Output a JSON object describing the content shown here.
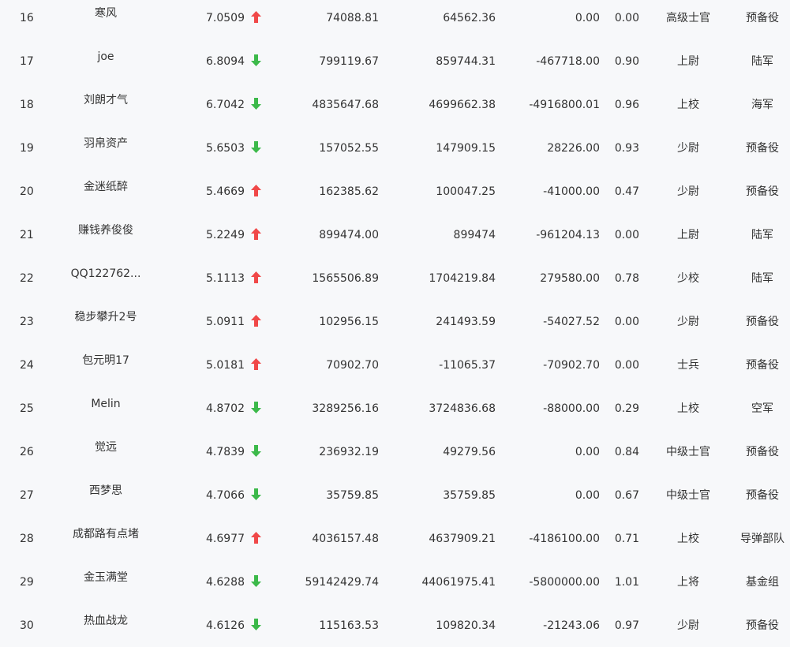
{
  "colors": {
    "up": "#f04848",
    "down": "#3cb94a",
    "text": "#333333",
    "background": "#f7f8fa"
  },
  "rows": [
    {
      "rank": "16",
      "name": "寒风",
      "score": "7.0509",
      "trend": "up",
      "v1": "74088.81",
      "v2": "64562.36",
      "v3": "0.00",
      "ratio": "0.00",
      "title": "高级士官",
      "unit": "预备役"
    },
    {
      "rank": "17",
      "name": "joe",
      "score": "6.8094",
      "trend": "down",
      "v1": "799119.67",
      "v2": "859744.31",
      "v3": "-467718.00",
      "ratio": "0.90",
      "title": "上尉",
      "unit": "陆军"
    },
    {
      "rank": "18",
      "name": "刘朗才气",
      "score": "6.7042",
      "trend": "down",
      "v1": "4835647.68",
      "v2": "4699662.38",
      "v3": "-4916800.01",
      "ratio": "0.96",
      "title": "上校",
      "unit": "海军"
    },
    {
      "rank": "19",
      "name": "羽帛资产",
      "score": "5.6503",
      "trend": "down",
      "v1": "157052.55",
      "v2": "147909.15",
      "v3": "28226.00",
      "ratio": "0.93",
      "title": "少尉",
      "unit": "预备役"
    },
    {
      "rank": "20",
      "name": "金迷纸醉",
      "score": "5.4669",
      "trend": "up",
      "v1": "162385.62",
      "v2": "100047.25",
      "v3": "-41000.00",
      "ratio": "0.47",
      "title": "少尉",
      "unit": "预备役"
    },
    {
      "rank": "21",
      "name": "赚钱养俊俊",
      "score": "5.2249",
      "trend": "up",
      "v1": "899474.00",
      "v2": "899474",
      "v3": "-961204.13",
      "ratio": "0.00",
      "title": "上尉",
      "unit": "陆军"
    },
    {
      "rank": "22",
      "name": "QQ122762...",
      "score": "5.1113",
      "trend": "up",
      "v1": "1565506.89",
      "v2": "1704219.84",
      "v3": "279580.00",
      "ratio": "0.78",
      "title": "少校",
      "unit": "陆军"
    },
    {
      "rank": "23",
      "name": "稳步攀升2号",
      "score": "5.0911",
      "trend": "up",
      "v1": "102956.15",
      "v2": "241493.59",
      "v3": "-54027.52",
      "ratio": "0.00",
      "title": "少尉",
      "unit": "预备役"
    },
    {
      "rank": "24",
      "name": "包元明17",
      "score": "5.0181",
      "trend": "up",
      "v1": "70902.70",
      "v2": "-11065.37",
      "v3": "-70902.70",
      "ratio": "0.00",
      "title": "士兵",
      "unit": "预备役"
    },
    {
      "rank": "25",
      "name": "Melin",
      "score": "4.8702",
      "trend": "down",
      "v1": "3289256.16",
      "v2": "3724836.68",
      "v3": "-88000.00",
      "ratio": "0.29",
      "title": "上校",
      "unit": "空军"
    },
    {
      "rank": "26",
      "name": "觉远",
      "score": "4.7839",
      "trend": "down",
      "v1": "236932.19",
      "v2": "49279.56",
      "v3": "0.00",
      "ratio": "0.84",
      "title": "中级士官",
      "unit": "预备役"
    },
    {
      "rank": "27",
      "name": "西梦思",
      "score": "4.7066",
      "trend": "down",
      "v1": "35759.85",
      "v2": "35759.85",
      "v3": "0.00",
      "ratio": "0.67",
      "title": "中级士官",
      "unit": "预备役"
    },
    {
      "rank": "28",
      "name": "成都路有点堵",
      "score": "4.6977",
      "trend": "up",
      "v1": "4036157.48",
      "v2": "4637909.21",
      "v3": "-4186100.00",
      "ratio": "0.71",
      "title": "上校",
      "unit": "导弹部队"
    },
    {
      "rank": "29",
      "name": "金玉满堂",
      "score": "4.6288",
      "trend": "down",
      "v1": "59142429.74",
      "v2": "44061975.41",
      "v3": "-5800000.00",
      "ratio": "1.01",
      "title": "上将",
      "unit": "基金组"
    },
    {
      "rank": "30",
      "name": "热血战龙",
      "score": "4.6126",
      "trend": "down",
      "v1": "115163.53",
      "v2": "109820.34",
      "v3": "-21243.06",
      "ratio": "0.97",
      "title": "少尉",
      "unit": "预备役"
    }
  ]
}
